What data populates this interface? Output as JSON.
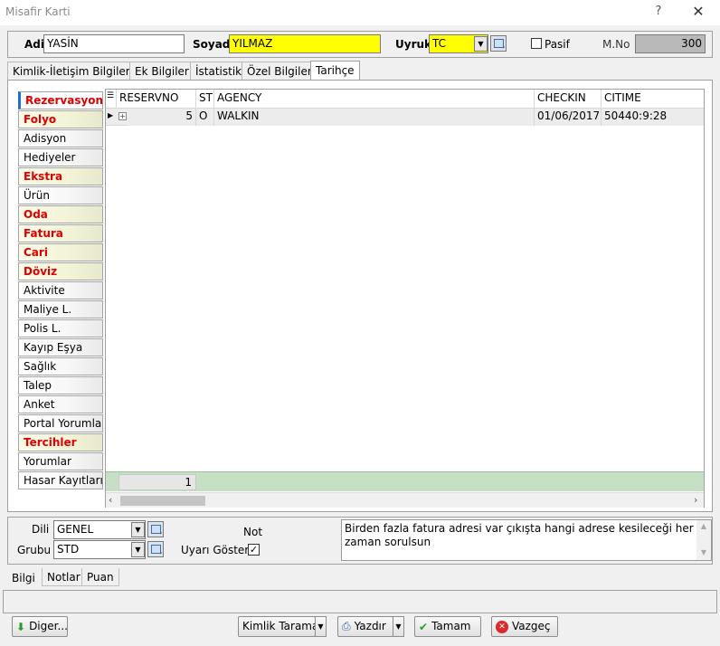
{
  "window": {
    "title": "Misafir Karti",
    "help": "?",
    "close": "✕"
  },
  "header": {
    "adi_label": "Adi",
    "adi_value": "YASİN",
    "soyadi_label": "Soyadi",
    "soyadi_value": "YILMAZ",
    "uyruk_label": "Uyruk",
    "uyruk_value": "TC",
    "pasif_label": "Pasif",
    "mno_label": "M.No",
    "mno_value": "300"
  },
  "tabs": [
    {
      "label": "Kimlik-İletişim Bilgileri"
    },
    {
      "label": "Ek Bilgiler"
    },
    {
      "label": "İstatistik"
    },
    {
      "label": "Özel Bilgiler"
    },
    {
      "label": "Tarihçe"
    }
  ],
  "side_menu": [
    {
      "label": "Rezervasyon"
    },
    {
      "label": "Folyo"
    },
    {
      "label": "Adisyon"
    },
    {
      "label": "Hediyeler"
    },
    {
      "label": "Ekstra"
    },
    {
      "label": "Ürün"
    },
    {
      "label": "Oda"
    },
    {
      "label": "Fatura"
    },
    {
      "label": "Cari"
    },
    {
      "label": "Döviz"
    },
    {
      "label": "Aktivite"
    },
    {
      "label": "Maliye L."
    },
    {
      "label": "Polis L."
    },
    {
      "label": "Kayıp Eşya"
    },
    {
      "label": "Sağlık"
    },
    {
      "label": "Talep"
    },
    {
      "label": "Anket"
    },
    {
      "label": "Portal Yorumları"
    },
    {
      "label": "Tercihler"
    },
    {
      "label": "Yorumlar"
    },
    {
      "label": "Hasar Kayıtları"
    }
  ],
  "grid": {
    "columns": [
      "RESERVNO",
      "ST",
      "AGENCY",
      "CHECKIN",
      "CITIME"
    ],
    "rows": [
      {
        "reservno": "5",
        "st": "O",
        "agency": "WALKIN",
        "checkin": "01/06/2017",
        "citime": "50440:9:28"
      }
    ],
    "footer_count": "1"
  },
  "info": {
    "dili_label": "Dili",
    "dili_value": "GENEL",
    "grubu_label": "Grubu",
    "grubu_value": "STD",
    "not_label": "Not",
    "uyari_label": "Uyarı Göster",
    "memo": "Birden fazla fatura adresi var çıkışta hangi adrese kesileceği her zaman sorulsun"
  },
  "bottom_tabs": [
    {
      "label": "Bilgi"
    },
    {
      "label": "Notlar"
    },
    {
      "label": "Puan"
    }
  ],
  "buttons": {
    "diger": "Diger...",
    "kimlik_tarama": "Kimlik Tarama",
    "yazdir": "Yazdır",
    "tamam": "Tamam",
    "vazgec": "Vazgeç"
  },
  "colors": {
    "highlight_yellow": "#ffff00",
    "footer_green": "#c6e0c6",
    "menu_red": "#e00000",
    "accent_blue": "#1f6fd0"
  }
}
